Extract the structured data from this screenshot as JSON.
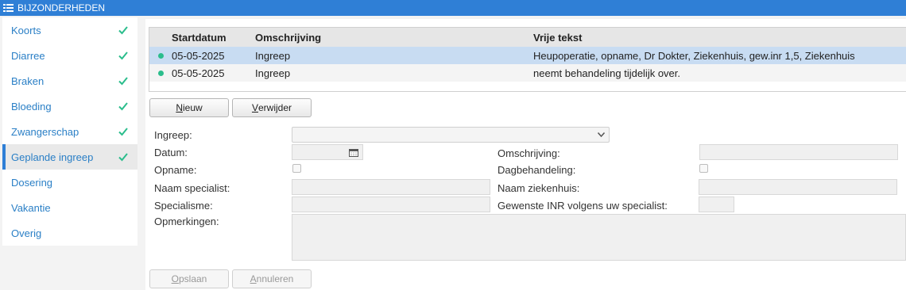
{
  "window": {
    "title": "BIJZONDERHEDEN",
    "icon": "list-icon"
  },
  "sidebar": {
    "items": [
      {
        "label": "Koorts",
        "checked": true
      },
      {
        "label": "Diarree",
        "checked": true
      },
      {
        "label": "Braken",
        "checked": true
      },
      {
        "label": "Bloeding",
        "checked": true
      },
      {
        "label": "Zwangerschap",
        "checked": true
      },
      {
        "label": "Geplande ingreep",
        "checked": true,
        "active": true
      },
      {
        "label": "Dosering",
        "checked": false
      },
      {
        "label": "Vakantie",
        "checked": false
      },
      {
        "label": "Overig",
        "checked": false
      }
    ],
    "check_color": "#2bbd8c"
  },
  "grid": {
    "columns": [
      "Startdatum",
      "Omschrijving",
      "Vrije tekst"
    ],
    "rows": [
      {
        "startdatum": "05-05-2025",
        "omschrijving": "Ingreep",
        "vrije_tekst": "Heupoperatie, opname, Dr Dokter, Ziekenhuis, gew.inr 1,5, Ziekenhuis",
        "selected": true
      },
      {
        "startdatum": "05-05-2025",
        "omschrijving": "Ingreep",
        "vrije_tekst": "neemt behandeling tijdelijk over.",
        "selected": false
      }
    ]
  },
  "actions": {
    "new_label": "Nieuw",
    "new_key": "N",
    "new_rest": "ieuw",
    "delete_key": "V",
    "delete_rest": "erwijder"
  },
  "form": {
    "ingreep_label": "Ingreep:",
    "ingreep_value": "",
    "datum_label": "Datum:",
    "datum_value": "",
    "omschrijving_label": "Omschrijving:",
    "omschrijving_value": "",
    "opname_label": "Opname:",
    "opname_checked": false,
    "dagbehandeling_label": "Dagbehandeling:",
    "dagbehandeling_checked": false,
    "naam_specialist_label": "Naam specialist:",
    "naam_specialist_value": "",
    "naam_ziekenhuis_label": "Naam ziekenhuis:",
    "naam_ziekenhuis_value": "",
    "specialisme_label": "Specialisme:",
    "specialisme_value": "",
    "gewenste_inr_label": "Gewenste INR volgens uw specialist:",
    "gewenste_inr_value": "",
    "opmerkingen_label": "Opmerkingen:",
    "opmerkingen_value": ""
  },
  "footer": {
    "save_key": "O",
    "save_rest": "pslaan",
    "cancel_key": "A",
    "cancel_rest": "nnuleren"
  },
  "colors": {
    "accent": "#2f7fd6",
    "link": "#2a7fc6",
    "selected_row": "#c8dcf2"
  }
}
